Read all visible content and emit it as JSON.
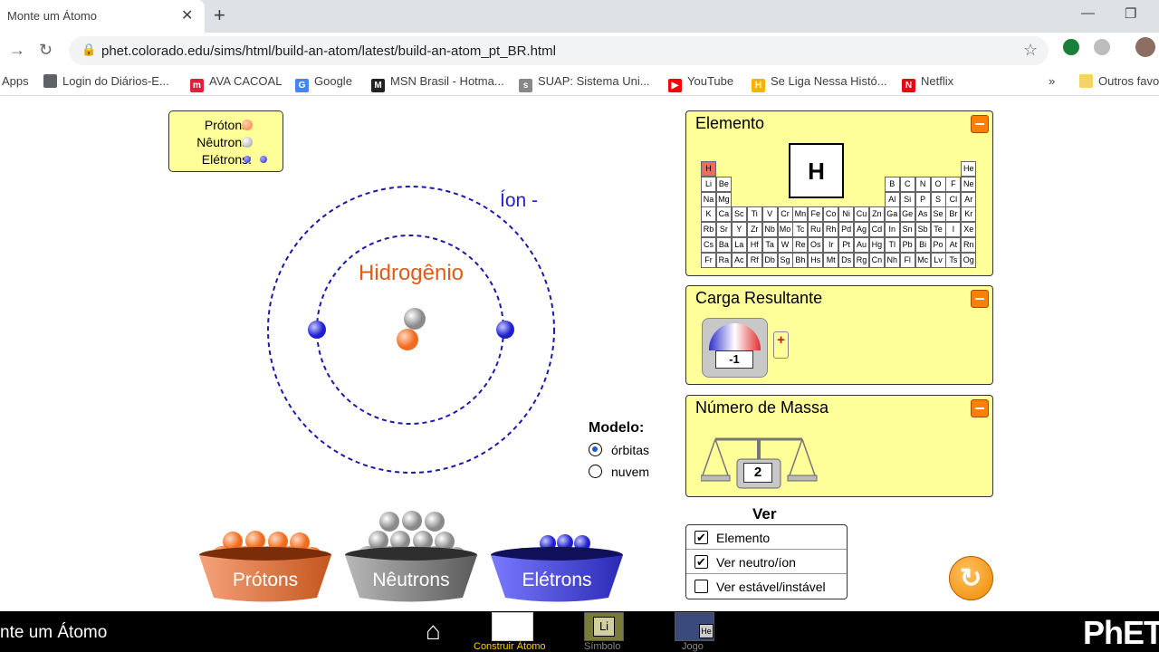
{
  "browser": {
    "tab_title": "Monte um Átomo",
    "tab_close": "✕",
    "new_tab": "+",
    "minimize": "—",
    "restore": "❐",
    "url": "phet.colorado.edu/sims/html/build-an-atom/latest/build-an-atom_pt_BR.html",
    "bookmarks": [
      {
        "label": "Apps",
        "icon": "apps-icon",
        "color": "#1a73e8",
        "glyph": ""
      },
      {
        "label": "Login do Diários-E...",
        "icon": "globe-icon",
        "color": "#5f6368",
        "glyph": ""
      },
      {
        "label": "AVA CACOAL",
        "icon": "moodle-icon",
        "color": "#e0203a",
        "glyph": "m"
      },
      {
        "label": "Google",
        "icon": "google-icon",
        "color": "#4285f4",
        "glyph": "G"
      },
      {
        "label": "MSN Brasil - Hotma...",
        "icon": "msn-icon",
        "color": "#222",
        "glyph": "M"
      },
      {
        "label": "SUAP: Sistema Uni...",
        "icon": "suap-icon",
        "color": "#888",
        "glyph": "s"
      },
      {
        "label": "YouTube",
        "icon": "youtube-icon",
        "color": "#ff0000",
        "glyph": "▶"
      },
      {
        "label": "Se Liga Nessa Histó...",
        "icon": "seliga-icon",
        "color": "#f4b400",
        "glyph": "H"
      },
      {
        "label": "Netflix",
        "icon": "netflix-icon",
        "color": "#e50914",
        "glyph": "N"
      }
    ],
    "bookmarks_more": "»",
    "other_bookmarks": "Outros favo"
  },
  "sim": {
    "legend": {
      "protons": "Prótons:",
      "neutrons": "Nêutrons:",
      "electrons": "Elétrons:"
    },
    "ion_label": "Íon -",
    "element_name": "Hidrogênio",
    "model": {
      "title": "Modelo:",
      "orbits": "órbitas",
      "cloud": "nuvem",
      "selected": "órbitas"
    },
    "buckets": {
      "protons": "Prótons",
      "neutrons": "Nêutrons",
      "electrons": "Elétrons"
    },
    "element_panel": {
      "title": "Elemento",
      "symbol": "H",
      "rows": [
        [
          "H",
          "",
          "",
          "",
          "",
          "",
          "",
          "",
          "",
          "",
          "",
          "",
          "",
          "",
          "",
          "",
          "",
          "He"
        ],
        [
          "Li",
          "Be",
          "",
          "",
          "",
          "",
          "",
          "",
          "",
          "",
          "",
          "",
          "B",
          "C",
          "N",
          "O",
          "F",
          "Ne"
        ],
        [
          "Na",
          "Mg",
          "",
          "",
          "",
          "",
          "",
          "",
          "",
          "",
          "",
          "",
          "Al",
          "Si",
          "P",
          "S",
          "Cl",
          "Ar"
        ],
        [
          "K",
          "Ca",
          "Sc",
          "Ti",
          "V",
          "Cr",
          "Mn",
          "Fe",
          "Co",
          "Ni",
          "Cu",
          "Zn",
          "Ga",
          "Ge",
          "As",
          "Se",
          "Br",
          "Kr"
        ],
        [
          "Rb",
          "Sr",
          "Y",
          "Zr",
          "Nb",
          "Mo",
          "Tc",
          "Ru",
          "Rh",
          "Pd",
          "Ag",
          "Cd",
          "In",
          "Sn",
          "Sb",
          "Te",
          "I",
          "Xe"
        ],
        [
          "Cs",
          "Ba",
          "La",
          "Hf",
          "Ta",
          "W",
          "Re",
          "Os",
          "Ir",
          "Pt",
          "Au",
          "Hg",
          "Tl",
          "Pb",
          "Bi",
          "Po",
          "At",
          "Rn"
        ],
        [
          "Fr",
          "Ra",
          "Ac",
          "Rf",
          "Db",
          "Sg",
          "Bh",
          "Hs",
          "Mt",
          "Ds",
          "Rg",
          "Cn",
          "Nh",
          "Fl",
          "Mc",
          "Lv",
          "Ts",
          "Og"
        ]
      ]
    },
    "charge_panel": {
      "title": "Carga Resultante",
      "value": "-1"
    },
    "mass_panel": {
      "title": "Número de Massa",
      "value": "2"
    },
    "view": {
      "title": "Ver",
      "items": [
        {
          "label": "Elemento",
          "checked": true
        },
        {
          "label": "Ver neutro/íon",
          "checked": true
        },
        {
          "label": "Ver estável/instável",
          "checked": false
        }
      ]
    },
    "reset_icon": "reset-icon"
  },
  "navbar": {
    "sim_title": "nte um Átomo",
    "screens": [
      {
        "label": "Construir Átomo",
        "active": true
      },
      {
        "label": "Símbolo",
        "active": false
      },
      {
        "label": "Jogo",
        "active": false
      }
    ],
    "symbol_screen_glyph": "Li",
    "game_screen_glyph": "He",
    "logo": "PhET"
  },
  "colors": {
    "panel": "#ffff99",
    "proton": "#ff7f3a",
    "neutron": "#b0b0b0",
    "electron": "#3a3aff",
    "accent": "#ff7f00",
    "active_screen": "#ffd200"
  }
}
